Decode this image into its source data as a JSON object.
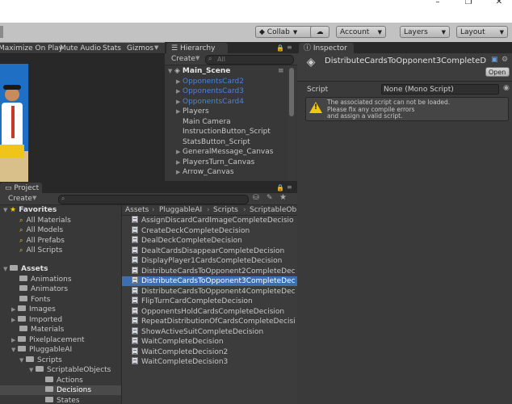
{
  "window": {
    "minimize": "–",
    "maximize": "❐",
    "close": "✕"
  },
  "toolbar": {
    "collab": "Collab",
    "account": "Account",
    "layers": "Layers",
    "layout": "Layout"
  },
  "game_bar": {
    "maximize_on_play": "Maximize On Play",
    "mute_audio": "Mute Audio",
    "stats": "Stats",
    "gizmos": "Gizmos"
  },
  "hierarchy": {
    "tab": "Hierarchy",
    "create": "Create",
    "search_placeholder": "All",
    "scene": "Main_Scene",
    "items": [
      {
        "label": "OpponentsCard2"
      },
      {
        "label": "OpponentsCard3"
      },
      {
        "label": "OpponentsCard4"
      },
      {
        "label": "Players"
      },
      {
        "label": "Main Camera"
      },
      {
        "label": "InstructionButton_Script"
      },
      {
        "label": "StatsButton_Script"
      },
      {
        "label": "GeneralMessage_Canvas"
      },
      {
        "label": "PlayersTurn_Canvas"
      },
      {
        "label": "Arrow_Canvas"
      }
    ]
  },
  "inspector": {
    "tab": "Inspector",
    "title": "DistributeCardsToOpponent3CompleteD",
    "open_button": "Open",
    "script_label": "Script",
    "script_value": "None (Mono Script)",
    "warning_line1": "The associated script can not be loaded.",
    "warning_line2": "Please fix any compile errors",
    "warning_line3": "and assign a valid script."
  },
  "project": {
    "tab": "Project",
    "create": "Create",
    "favorites": {
      "label": "Favorites",
      "items": [
        {
          "label": "All Materials"
        },
        {
          "label": "All Models"
        },
        {
          "label": "All Prefabs"
        },
        {
          "label": "All Scripts"
        }
      ]
    },
    "assets": {
      "label": "Assets",
      "items": [
        {
          "label": "Animations"
        },
        {
          "label": "Animators"
        },
        {
          "label": "Fonts"
        },
        {
          "label": "Images"
        },
        {
          "label": "Imported"
        },
        {
          "label": "Materials"
        },
        {
          "label": "Pixelplacement"
        },
        {
          "label": "PluggableAI"
        },
        {
          "label": "Scripts"
        },
        {
          "label": "ScriptableObjects"
        },
        {
          "label": "Actions"
        },
        {
          "label": "Decisions"
        },
        {
          "label": "States"
        }
      ]
    },
    "breadcrumb": [
      "Assets",
      "PluggableAI",
      "Scripts",
      "ScriptableOb"
    ],
    "files": [
      {
        "label": "AssignDiscardCardImageCompleteDecisio"
      },
      {
        "label": "CreateDeckCompleteDecision"
      },
      {
        "label": "DealDeckCompleteDecision"
      },
      {
        "label": "DealtCardsDisappearCompleteDecision"
      },
      {
        "label": "DisplayPlayer1CardsCompleteDecision"
      },
      {
        "label": "DistributeCardsToOpponent2CompleteDec"
      },
      {
        "label": "DistributeCardsToOpponent3CompleteDec"
      },
      {
        "label": "DistributeCardsToOpponent4CompleteDec"
      },
      {
        "label": "FlipTurnCardCompleteDecision"
      },
      {
        "label": "OpponentsHoldCardsCompleteDecision"
      },
      {
        "label": "RepeatDistributionOfCardsCompleteDecisi"
      },
      {
        "label": "ShowActiveSuitCompleteDecision"
      },
      {
        "label": "WaitCompleteDecision"
      },
      {
        "label": "WaitCompleteDecision2"
      },
      {
        "label": "WaitCompleteDecision3"
      }
    ]
  },
  "colors": {
    "selection": "#3d6fb0",
    "prefab_blue": "#4a84d8"
  }
}
